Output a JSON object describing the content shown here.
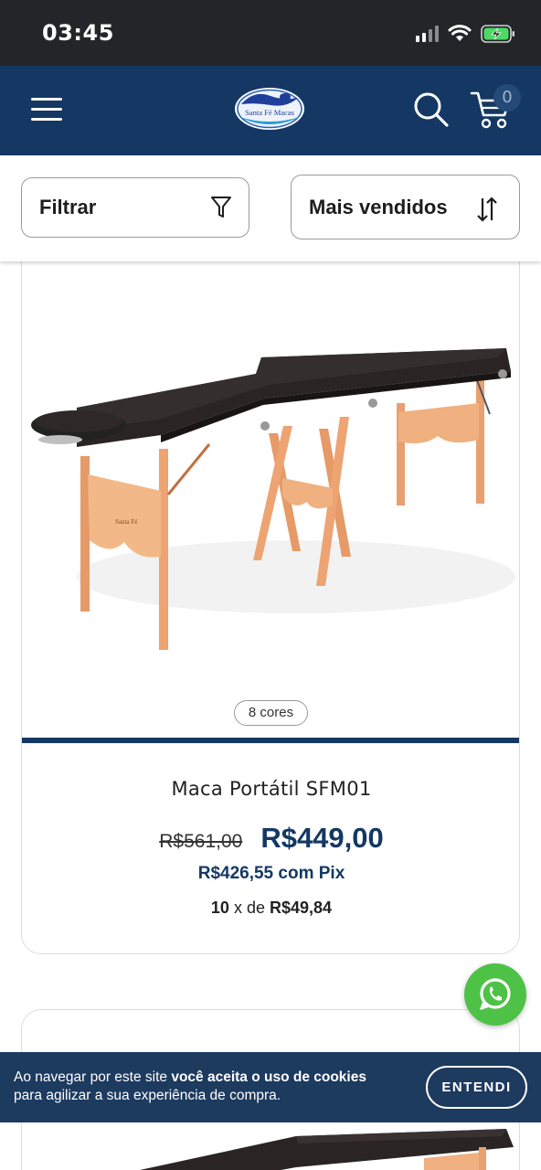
{
  "status_bar": {
    "time": "03:45"
  },
  "header": {
    "logo_text": "Santa Fé Macas",
    "cart_count": "0",
    "colors": {
      "background": "#143863"
    }
  },
  "filter_bar": {
    "filter_label": "Filtrar",
    "sort_label": "Mais vendidos"
  },
  "products": [
    {
      "colors_badge": "8 cores",
      "name": "Maca Portátil SFM01",
      "old_price": "R$561,00",
      "price": "R$449,00",
      "pix_price": "R$426,55 com Pix",
      "installments_count": "10",
      "installments_sep": "x de",
      "installment_value": "R$49,84"
    }
  ],
  "cookie_banner": {
    "text_pre": "Ao navegar por este site ",
    "text_bold": "você aceita o uso de cookies",
    "text_post": "para agilizar a sua experiência de compra.",
    "button_label": "ENTENDI"
  },
  "icons": {
    "menu": "hamburger-menu-icon",
    "search": "search-icon",
    "cart": "cart-icon",
    "filter": "funnel-icon",
    "sort": "sort-arrows-icon",
    "whatsapp": "whatsapp-icon"
  }
}
